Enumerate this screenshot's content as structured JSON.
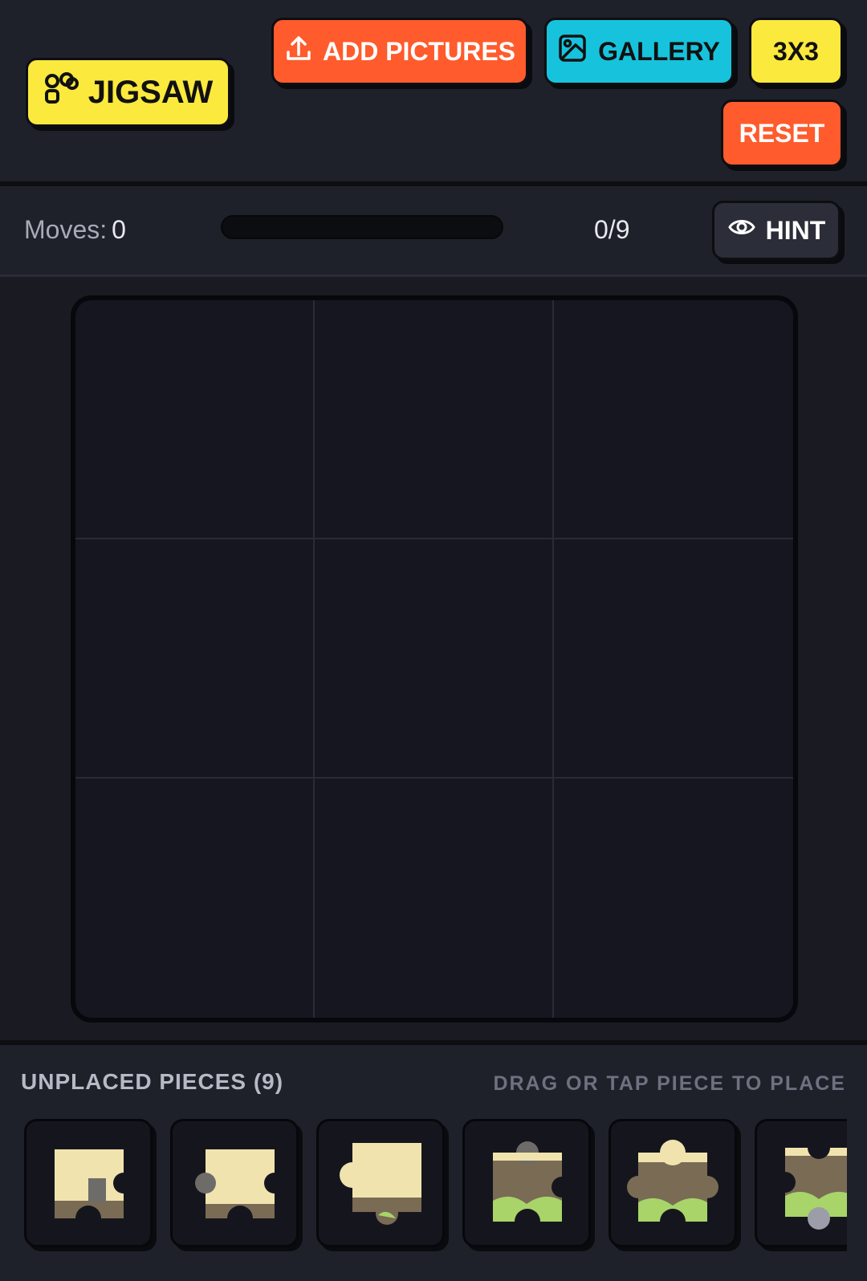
{
  "header": {
    "logo_label": "JIGSAW",
    "add_pictures_label": "ADD PICTURES",
    "gallery_label": "GALLERY",
    "grid_size_label": "3X3",
    "reset_label": "RESET"
  },
  "status": {
    "moves_label": "Moves:",
    "moves_value": "0",
    "progress_fraction": 0,
    "placed_count": "0/9",
    "hint_label": "HINT"
  },
  "board": {
    "rows": 3,
    "cols": 3,
    "placed": 0
  },
  "tray": {
    "title": "UNPLACED PIECES (9)",
    "help": "DRAG OR TAP PIECE TO PLACE",
    "visible_pieces": 6
  },
  "colors": {
    "yellow": "#fbe93d",
    "orange": "#ff5b2c",
    "cyan": "#17c3dc",
    "sky": "#f3e6b4",
    "grass": "#a8d46a",
    "fence": "#7a6b55",
    "building": "#6e6c68"
  },
  "icons": [
    "puzzle-logo-icon",
    "upload-icon",
    "image-icon",
    "eye-icon"
  ]
}
